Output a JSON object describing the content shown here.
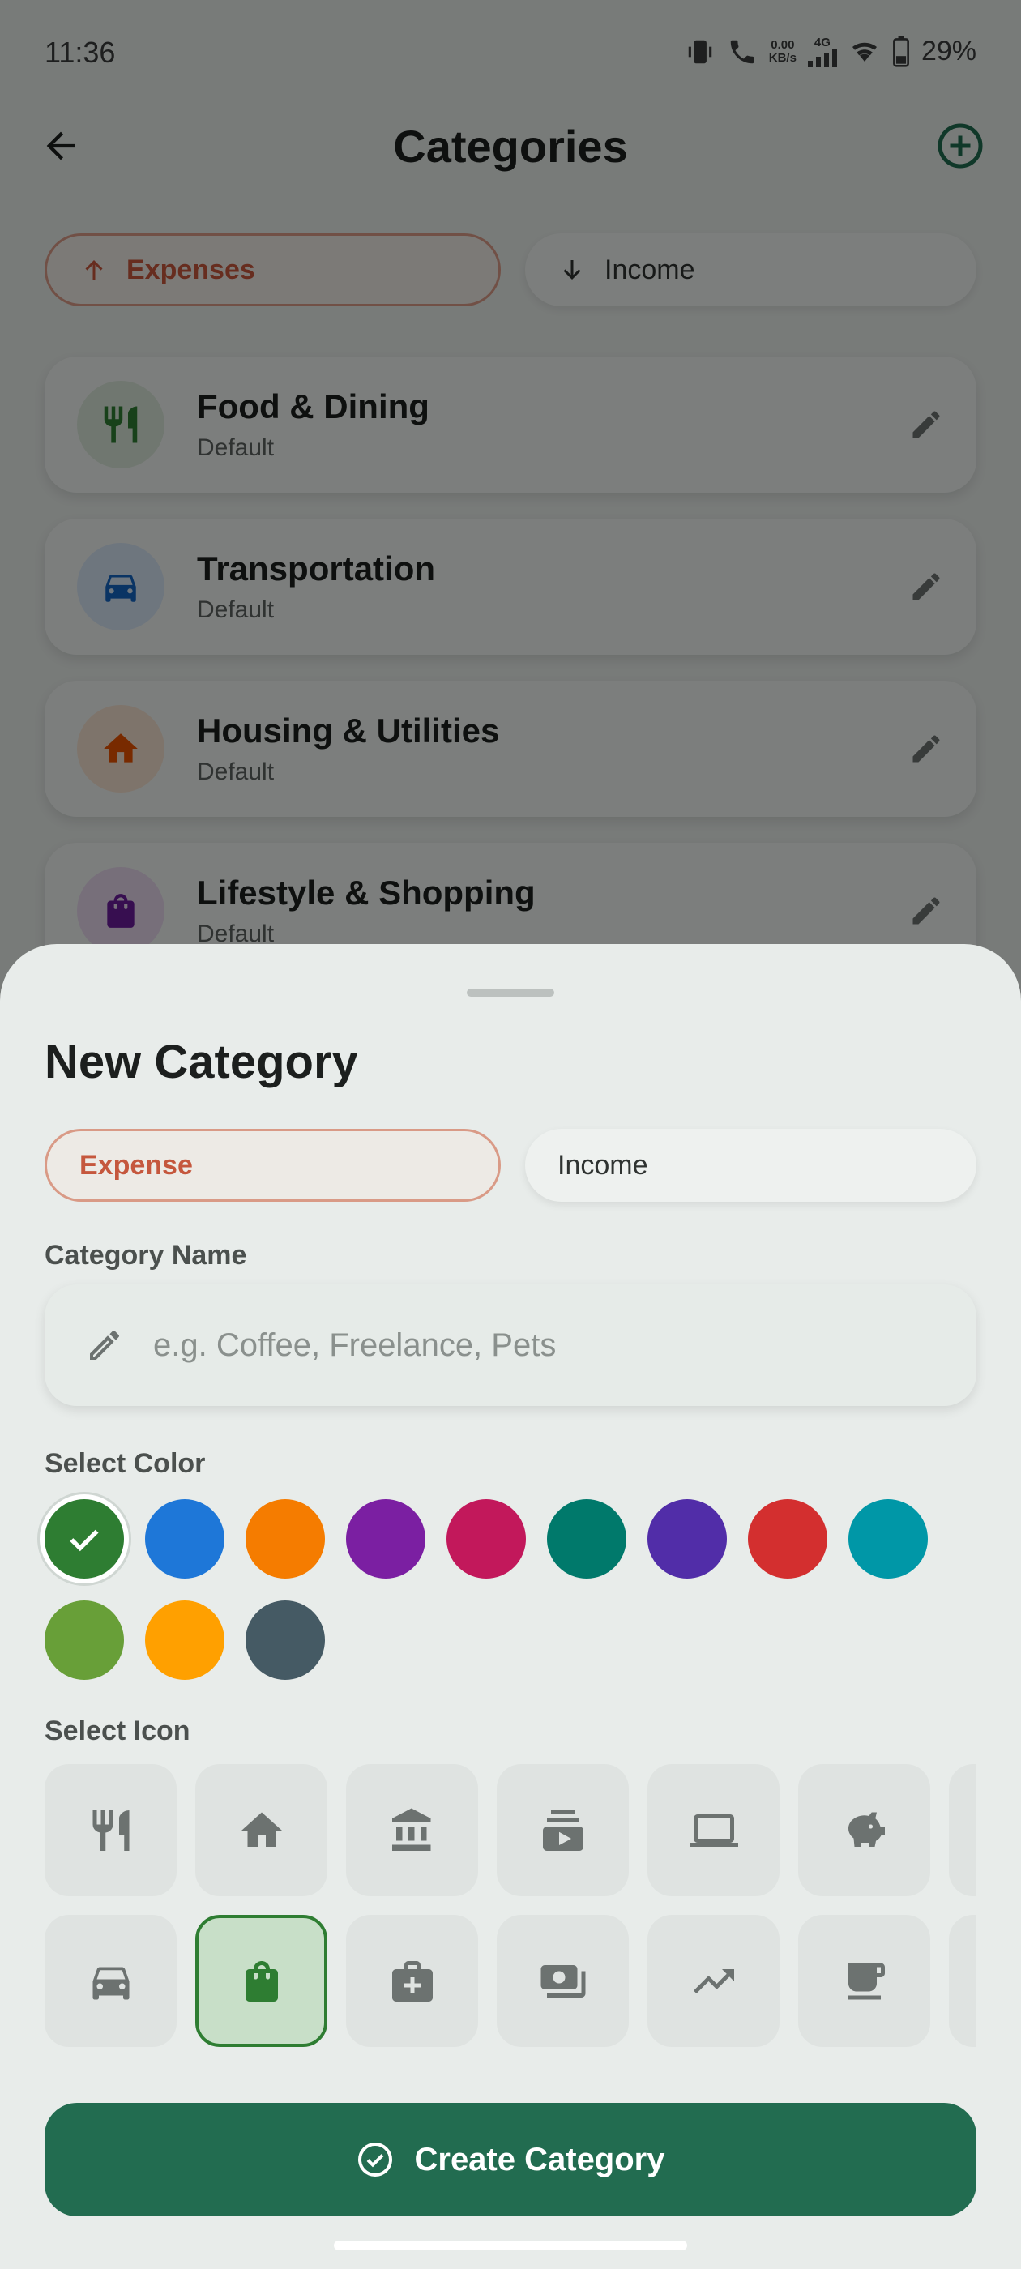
{
  "status_bar": {
    "time": "11:36",
    "net_speed_value": "0.00",
    "net_speed_unit": "KB/s",
    "network_type": "4G",
    "battery": "29%"
  },
  "header": {
    "title": "Categories"
  },
  "tabs": {
    "expenses_label": "Expenses",
    "income_label": "Income"
  },
  "categories": [
    {
      "name": "Food & Dining",
      "subtitle": "Default",
      "color": "#2e7d32",
      "icon": "fork-knife-icon"
    },
    {
      "name": "Transportation",
      "subtitle": "Default",
      "color": "#1565c0",
      "icon": "car-icon"
    },
    {
      "name": "Housing & Utilities",
      "subtitle": "Default",
      "color": "#e65100",
      "icon": "home-icon"
    },
    {
      "name": "Lifestyle & Shopping",
      "subtitle": "Default",
      "color": "#6a1b9a",
      "icon": "shopping-bag-icon"
    }
  ],
  "sheet": {
    "title": "New Category",
    "type_expense_label": "Expense",
    "type_income_label": "Income",
    "name_label": "Category Name",
    "name_placeholder": "e.g. Coffee, Freelance, Pets",
    "name_value": "",
    "color_label": "Select Color",
    "icon_label": "Select Icon",
    "create_label": "Create Category"
  },
  "colors": [
    "#2e7d32",
    "#1e77d8",
    "#f57c00",
    "#7b1fa2",
    "#c2185b",
    "#00796b",
    "#512da8",
    "#d32f2f",
    "#0097a7",
    "#689f38",
    "#ffa000",
    "#455a64"
  ],
  "selected_color": "#2e7d32",
  "icons": [
    "fork-knife-icon",
    "home-icon",
    "bank-icon",
    "subscriptions-icon",
    "laptop-icon",
    "piggy-bank-icon",
    "car-icon",
    "shopping-bag-icon",
    "medical-bag-icon",
    "payments-icon",
    "trending-up-icon",
    "coffee-icon"
  ],
  "selected_icon": "shopping-bag-icon"
}
